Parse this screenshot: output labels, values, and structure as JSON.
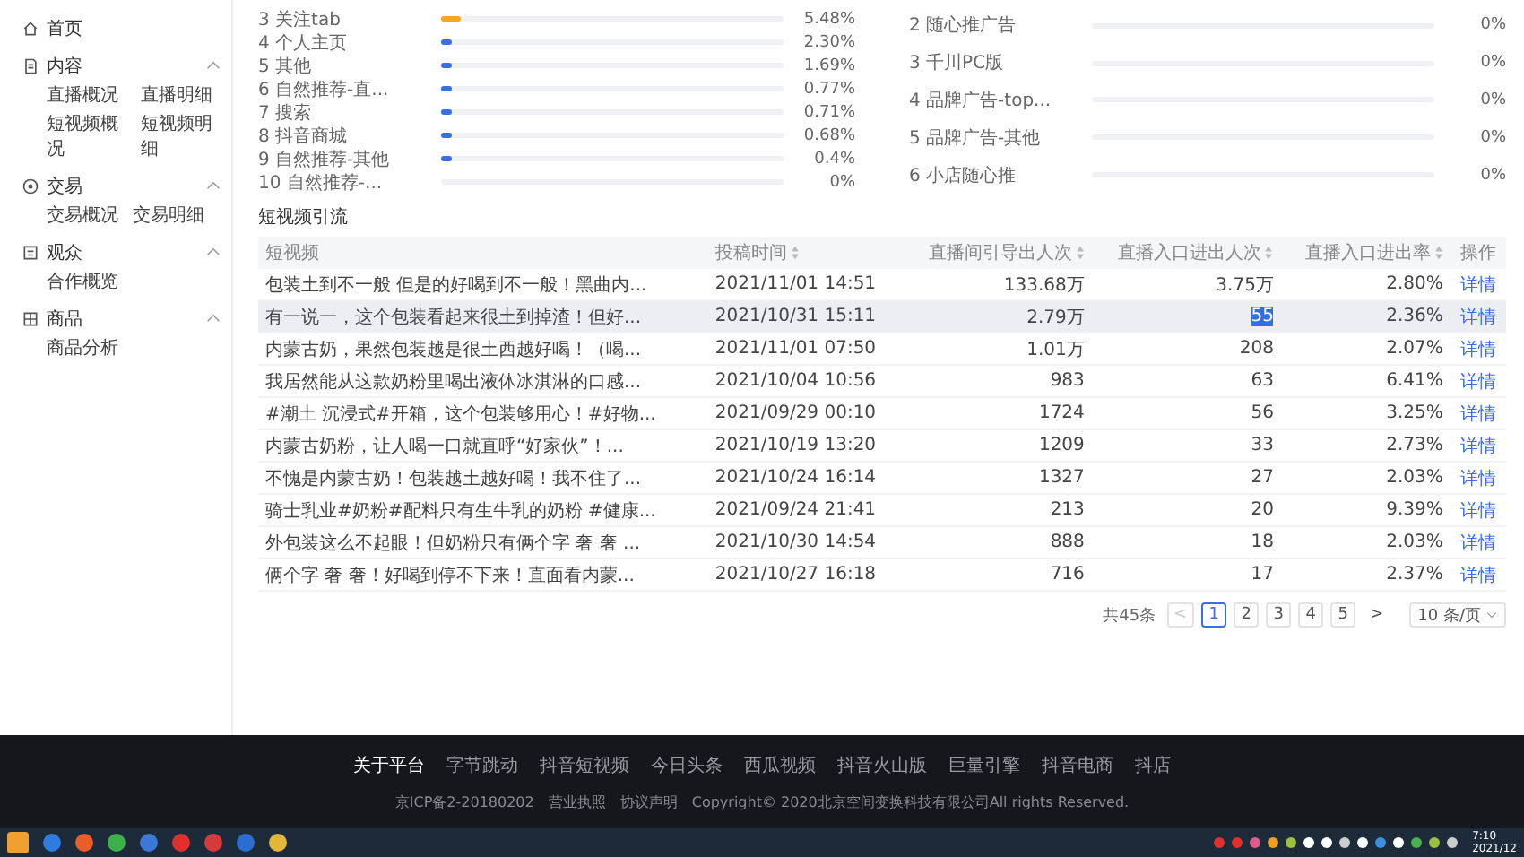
{
  "sidebar": [
    {
      "label": "首页"
    },
    {
      "label": "内容",
      "expanded": true,
      "children": [
        "直播概况",
        "直播明细",
        "短视频概况",
        "短视频明细"
      ]
    },
    {
      "label": "交易",
      "expanded": true,
      "children": [
        "交易概况",
        "交易明细"
      ]
    },
    {
      "label": "观众",
      "expanded": true,
      "children": [
        "合作概览"
      ]
    },
    {
      "label": "商品",
      "expanded": true,
      "children": [
        "商品分析"
      ]
    }
  ],
  "traffic_sources_left": [
    {
      "label": "3 关注tab",
      "level": 0.055,
      "value": "5.48%",
      "color": "#f5a623"
    },
    {
      "label": "4 个人主页",
      "level": 0.023,
      "value": "2.30%",
      "color": "#3b6fe0"
    },
    {
      "label": "5 其他",
      "level": 0.017,
      "value": "1.69%",
      "color": "#3b6fe0"
    },
    {
      "label": "6 自然推荐-直...",
      "level": 0.008,
      "value": "0.77%",
      "color": "#3b6fe0"
    },
    {
      "label": "7 搜索",
      "level": 0.007,
      "value": "0.71%",
      "color": "#3b6fe0"
    },
    {
      "label": "8 抖音商城",
      "level": 0.007,
      "value": "0.68%",
      "color": "#3b6fe0"
    },
    {
      "label": "9 自然推荐-其他",
      "level": 0.004,
      "value": "0.4%",
      "color": "#3b6fe0"
    },
    {
      "label": "10 自然推荐-...",
      "value": "0%"
    }
  ],
  "traffic_sources_right": [
    {
      "label": "2 随心推广告",
      "value": "0%"
    },
    {
      "label": "3 千川PC版",
      "value": "0%"
    },
    {
      "label": "4 品牌广告-top...",
      "value": "0%"
    },
    {
      "label": "5 品牌广告-其他",
      "value": "0%"
    },
    {
      "label": "6 小店随心推",
      "value": "0%"
    }
  ],
  "section_title": "短视频引流",
  "table": {
    "columns": [
      "短视频",
      "投稿时间",
      "直播间引导出人次",
      "直播入口进出人次",
      "直播入口进出率",
      "操作"
    ],
    "rows": [
      {
        "title": "包装土到不一般 但是的好喝到不一般！黑曲内...",
        "time": "2021/11/01 14:51",
        "guided": "133.68万",
        "entries": "3.75万",
        "rate": "2.80%",
        "action": "详情",
        "selected": false,
        "highlighted": false
      },
      {
        "title": "有一说一，这个包装看起来很土到掉渣！但好...",
        "time": "2021/10/31 15:11",
        "guided": "2.79万",
        "entries": "55",
        "rate": "2.36%",
        "action": "详情",
        "selected": true,
        "highlighted": true
      },
      {
        "title": "内蒙古奶，果然包装越是很土西越好喝！（喝...",
        "time": "2021/11/01 07:50",
        "guided": "1.01万",
        "entries": "208",
        "rate": "2.07%",
        "action": "详情",
        "selected": false,
        "highlighted": false
      },
      {
        "title": "我居然能从这款奶粉里喝出液体冰淇淋的口感...",
        "time": "2021/10/04 10:56",
        "guided": "983",
        "entries": "63",
        "rate": "6.41%",
        "action": "详情",
        "selected": false,
        "highlighted": false
      },
      {
        "title": "#潮土 沉浸式#开箱，这个包装够用心！#好物...",
        "time": "2021/09/29 00:10",
        "guided": "1724",
        "entries": "56",
        "rate": "3.25%",
        "action": "详情",
        "selected": false,
        "highlighted": false
      },
      {
        "title": "内蒙古奶粉，让人喝一口就直呼“好家伙”！...",
        "time": "2021/10/19 13:20",
        "guided": "1209",
        "entries": "33",
        "rate": "2.73%",
        "action": "详情",
        "selected": false,
        "highlighted": false
      },
      {
        "title": "不愧是内蒙古奶！包装越土越好喝！我不住了...",
        "time": "2021/10/24 16:14",
        "guided": "1327",
        "entries": "27",
        "rate": "2.03%",
        "action": "详情",
        "selected": false,
        "highlighted": false
      },
      {
        "title": "骑士乳业#奶粉#配料只有生牛乳的奶粉 #健康...",
        "time": "2021/09/24 21:41",
        "guided": "213",
        "entries": "20",
        "rate": "9.39%",
        "action": "详情",
        "selected": false,
        "highlighted": false
      },
      {
        "title": "外包装这么不起眼！但奶粉只有俩个字 奢 奢 ...",
        "time": "2021/10/30 14:54",
        "guided": "888",
        "entries": "18",
        "rate": "2.03%",
        "action": "详情",
        "selected": false,
        "highlighted": false
      },
      {
        "title": "俩个字 奢 奢！好喝到停不下来！直面看内蒙...",
        "time": "2021/10/27 16:18",
        "guided": "716",
        "entries": "17",
        "rate": "2.37%",
        "action": "详情",
        "selected": false,
        "highlighted": false
      }
    ]
  },
  "pagination": {
    "total": "共45条",
    "prev": "<",
    "next": ">",
    "pages": [
      {
        "label": "1",
        "selected": true
      },
      {
        "label": "2",
        "selected": false
      },
      {
        "label": "3",
        "selected": false
      },
      {
        "label": "4",
        "selected": false
      },
      {
        "label": "5",
        "selected": false
      }
    ],
    "page_size": "10 条/页"
  },
  "footer": {
    "links": [
      "关于平台",
      "字节跳动",
      "抖音短视频",
      "今日头条",
      "西瓜视频",
      "抖音火山版",
      "巨量引擎",
      "抖音电商",
      "抖店"
    ],
    "legal": [
      "京ICP备2-20180202",
      "营业执照",
      "协议声明",
      "Copyright© 2020北京空间变换科技有限公司All rights Reserved."
    ]
  },
  "taskbar": {
    "time": "7:10",
    "date": "2021/12"
  }
}
